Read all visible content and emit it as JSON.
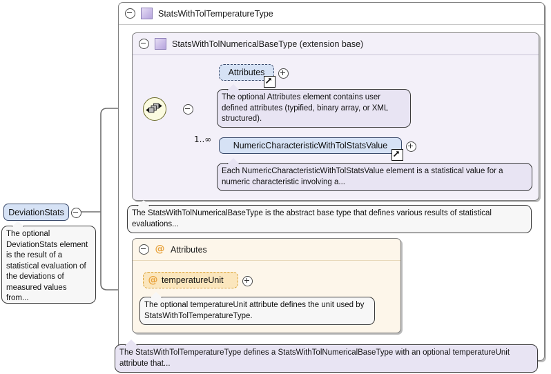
{
  "diagram": {
    "kind": "xml-schema-diagram",
    "root_element": {
      "name": "DeviationStats",
      "toggle": "minus",
      "documentation": "The optional DeviationStats element is the result of a statistical evaluation of the deviations of measured values from..."
    },
    "outer_type": {
      "title": "StatsWithTolTemperatureType",
      "toggle": "minus",
      "icon": "type-swatch-icon",
      "documentation": "The StatsWithTolTemperatureType defines a StatsWithTolNumericalBaseType with an optional temperatureUnit attribute that..."
    },
    "base_type": {
      "title": "StatsWithTolNumericalBaseType (extension base)",
      "toggle": "minus",
      "icon": "type-swatch-icon",
      "documentation": "The StatsWithTolNumericalBaseType is the abstract base type that defines various results of statistical evaluations...",
      "compositor": {
        "kind": "sequence",
        "toggle": "minus"
      },
      "children": [
        {
          "name": "Attributes",
          "occurrence": "",
          "required": false,
          "expander": "plus",
          "link": "go-to-definition-icon",
          "documentation": "The optional Attributes element contains user defined attributes (typified, binary array, or XML structured)."
        },
        {
          "name": "NumericCharacteristicWithTolStatsValue",
          "occurrence": "1..∞",
          "required": true,
          "expander": "plus",
          "link": "go-to-definition-icon",
          "documentation": "Each NumericCharacteristicWithTolStatsValue element is a statistical value for a numeric characteristic involving a..."
        }
      ]
    },
    "attributes_panel": {
      "title": "Attributes",
      "toggle": "minus",
      "icon": "at-icon",
      "items": [
        {
          "name": "temperatureUnit",
          "icon": "at-icon",
          "required": false,
          "expander": "plus",
          "documentation": "The optional temperatureUnit attribute defines the unit used by StatsWithTolTemperatureType."
        }
      ]
    },
    "colors": {
      "element_fill": "#d6e2f5",
      "element_stroke": "#3a4a6b",
      "attribute_fill": "#fbe6bd",
      "attribute_stroke": "#d9a236",
      "type_panel_fill": "#f3f0f9",
      "attr_panel_fill": "#fdf6ea",
      "doc_purple_fill": "#e8e4f3",
      "doc_gray_fill": "#f7f7f7",
      "compositor_fill": "#fbfbe0",
      "connector": "#6e6e6e"
    }
  }
}
